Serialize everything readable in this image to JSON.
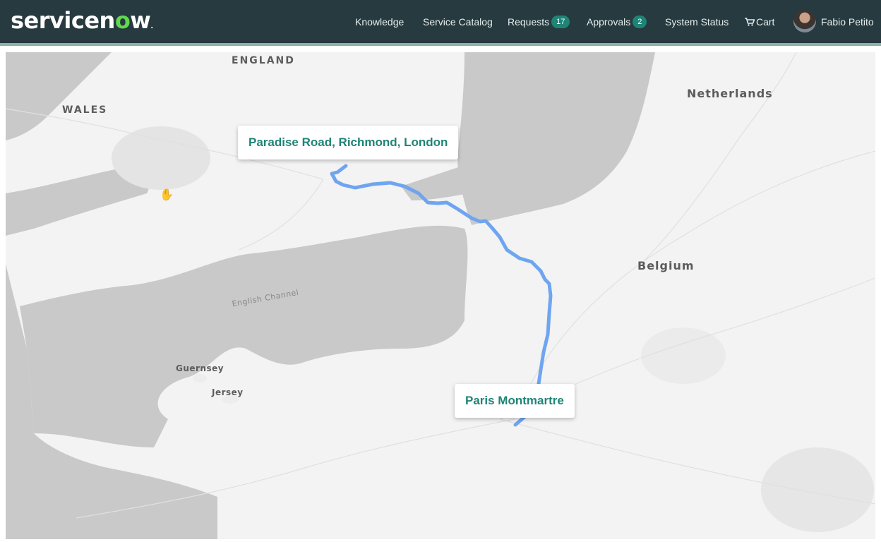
{
  "header": {
    "brand_pre": "servicen",
    "brand_o": "o",
    "brand_post": "w",
    "brand_tm": ".",
    "nav": {
      "knowledge": "Knowledge",
      "service_catalog": "Service Catalog",
      "requests": "Requests",
      "requests_count": "17",
      "approvals": "Approvals",
      "approvals_count": "2",
      "system_status": "System Status",
      "cart": "Cart"
    },
    "user_name": "Fabio Petito",
    "cart_icon": "shopping-cart-icon"
  },
  "map": {
    "labels": {
      "england": "ENGLAND",
      "wales": "WALES",
      "netherlands": "Netherlands",
      "belgium": "Belgium",
      "english_channel": "English Channel",
      "guernsey": "Guernsey",
      "jersey": "Jersey"
    },
    "origin": "Paradise Road, Richmond, London",
    "destination": "Paris Montmartre",
    "colors": {
      "sea": "#c9c9c9",
      "land": "#f3f3f3",
      "route": "#6fa5f0",
      "callout_text": "#1f8476"
    }
  }
}
